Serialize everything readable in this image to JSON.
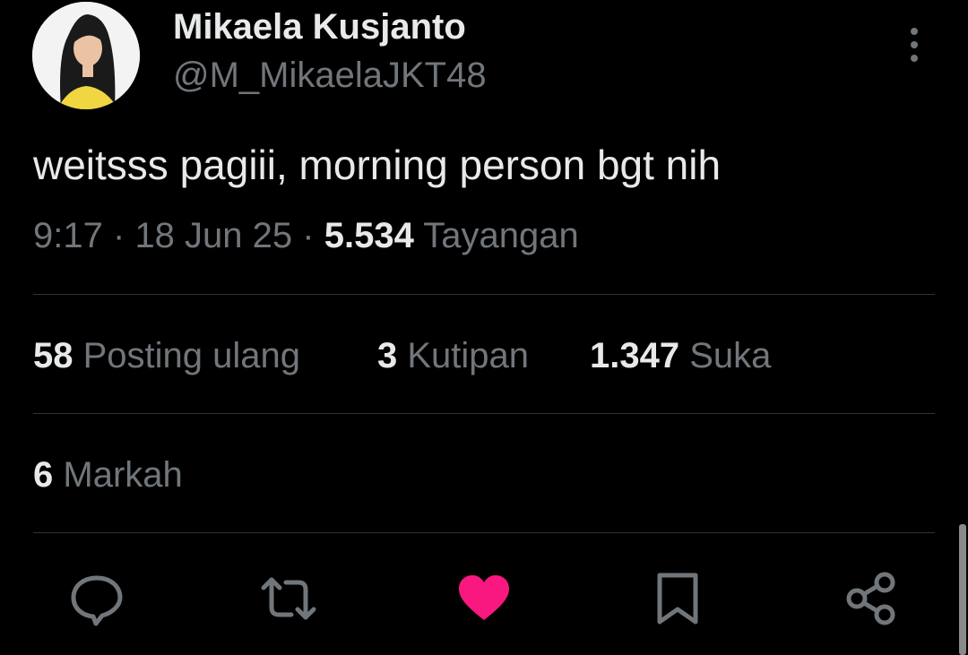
{
  "author": {
    "display_name": "Mikaela Kusjanto",
    "handle": "@M_MikaelaJKT48",
    "avatar_icon": "profile-photo"
  },
  "tweet": {
    "text": "weitsss pagiii, morning person bgt nih",
    "time": "9:17",
    "separator": "·",
    "date": "18 Jun 25",
    "views_count": "5.534",
    "views_label": "Tayangan"
  },
  "stats": {
    "reposts_count": "58",
    "reposts_label": "Posting ulang",
    "quotes_count": "3",
    "quotes_label": "Kutipan",
    "likes_count": "1.347",
    "likes_label": "Suka",
    "bookmarks_count": "6",
    "bookmarks_label": "Markah"
  },
  "actions": [
    "reply-icon",
    "repost-icon",
    "like-icon",
    "bookmark-icon",
    "share-icon"
  ],
  "colors": {
    "background": "#000000",
    "primary_text": "#e7e9ea",
    "secondary_text": "#71767b",
    "divider": "#2f3336",
    "like": "#f91880"
  }
}
